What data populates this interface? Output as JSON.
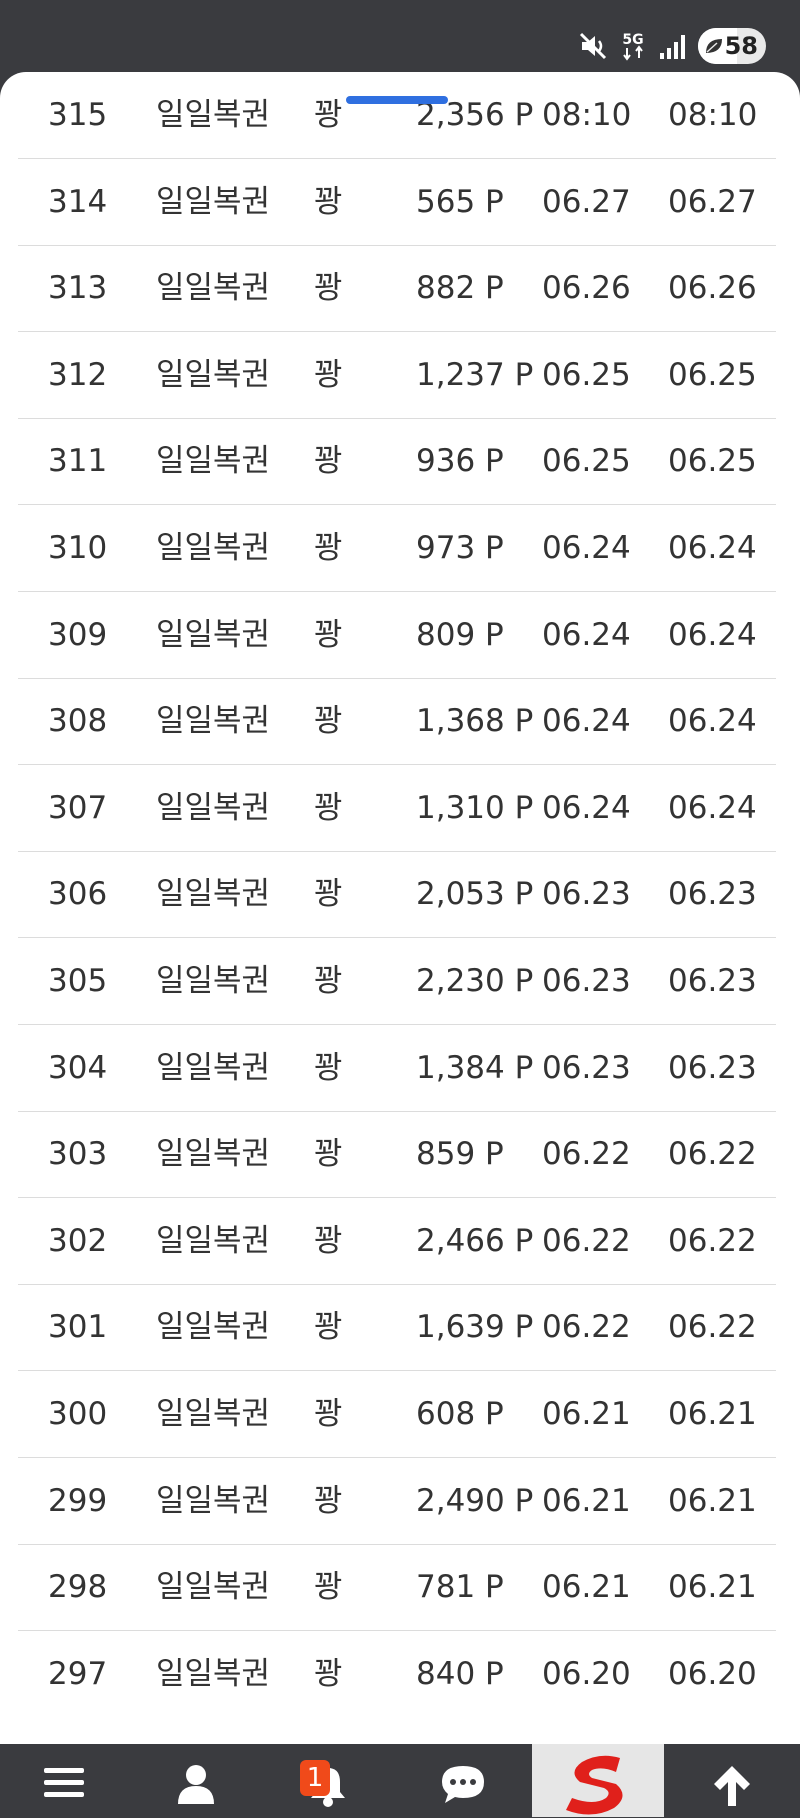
{
  "status_bar": {
    "network": "5G",
    "battery_percent": 58,
    "battery_label": "58"
  },
  "table": {
    "rows": [
      {
        "no": "315",
        "title": "일일복권",
        "result": "꽝",
        "points": "2,356 P",
        "date1": "08:10",
        "date2": "08:10"
      },
      {
        "no": "314",
        "title": "일일복권",
        "result": "꽝",
        "points": "565 P",
        "date1": "06.27",
        "date2": "06.27"
      },
      {
        "no": "313",
        "title": "일일복권",
        "result": "꽝",
        "points": "882 P",
        "date1": "06.26",
        "date2": "06.26"
      },
      {
        "no": "312",
        "title": "일일복권",
        "result": "꽝",
        "points": "1,237 P",
        "date1": "06.25",
        "date2": "06.25"
      },
      {
        "no": "311",
        "title": "일일복권",
        "result": "꽝",
        "points": "936 P",
        "date1": "06.25",
        "date2": "06.25"
      },
      {
        "no": "310",
        "title": "일일복권",
        "result": "꽝",
        "points": "973 P",
        "date1": "06.24",
        "date2": "06.24"
      },
      {
        "no": "309",
        "title": "일일복권",
        "result": "꽝",
        "points": "809 P",
        "date1": "06.24",
        "date2": "06.24"
      },
      {
        "no": "308",
        "title": "일일복권",
        "result": "꽝",
        "points": "1,368 P",
        "date1": "06.24",
        "date2": "06.24"
      },
      {
        "no": "307",
        "title": "일일복권",
        "result": "꽝",
        "points": "1,310 P",
        "date1": "06.24",
        "date2": "06.24"
      },
      {
        "no": "306",
        "title": "일일복권",
        "result": "꽝",
        "points": "2,053 P",
        "date1": "06.23",
        "date2": "06.23"
      },
      {
        "no": "305",
        "title": "일일복권",
        "result": "꽝",
        "points": "2,230 P",
        "date1": "06.23",
        "date2": "06.23"
      },
      {
        "no": "304",
        "title": "일일복권",
        "result": "꽝",
        "points": "1,384 P",
        "date1": "06.23",
        "date2": "06.23"
      },
      {
        "no": "303",
        "title": "일일복권",
        "result": "꽝",
        "points": "859 P",
        "date1": "06.22",
        "date2": "06.22"
      },
      {
        "no": "302",
        "title": "일일복권",
        "result": "꽝",
        "points": "2,466 P",
        "date1": "06.22",
        "date2": "06.22"
      },
      {
        "no": "301",
        "title": "일일복권",
        "result": "꽝",
        "points": "1,639 P",
        "date1": "06.22",
        "date2": "06.22"
      },
      {
        "no": "300",
        "title": "일일복권",
        "result": "꽝",
        "points": "608 P",
        "date1": "06.21",
        "date2": "06.21"
      },
      {
        "no": "299",
        "title": "일일복권",
        "result": "꽝",
        "points": "2,490 P",
        "date1": "06.21",
        "date2": "06.21"
      },
      {
        "no": "298",
        "title": "일일복권",
        "result": "꽝",
        "points": "781 P",
        "date1": "06.21",
        "date2": "06.21"
      },
      {
        "no": "297",
        "title": "일일복권",
        "result": "꽝",
        "points": "840 P",
        "date1": "06.20",
        "date2": "06.20"
      }
    ]
  },
  "bottom_nav": {
    "items": [
      {
        "icon": "menu-icon"
      },
      {
        "icon": "user-icon"
      },
      {
        "icon": "bell-icon",
        "badge": "1"
      },
      {
        "icon": "chat-icon"
      },
      {
        "icon": "site-logo-icon"
      },
      {
        "icon": "arrow-up-icon"
      }
    ]
  },
  "colors": {
    "status_bar_bg": "#3a3b3f",
    "scroll_indicator": "#2f6fe0",
    "badge": "#f04a1a",
    "logo_red": "#e0201b"
  }
}
